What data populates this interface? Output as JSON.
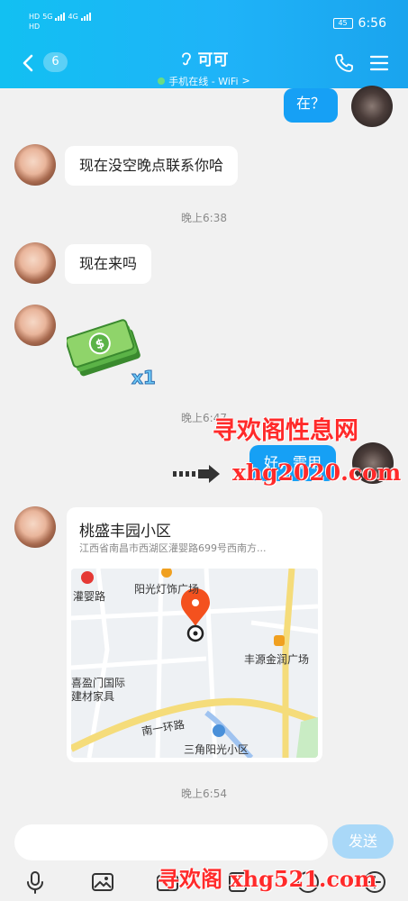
{
  "status": {
    "left_top": "HD",
    "left_bottom": "HD",
    "net_top": "5G",
    "net_mid": "4G",
    "battery": "45",
    "time": "6:56"
  },
  "header": {
    "unread_count": "6",
    "title": "可可",
    "subtitle": "手机在线 - WiFi",
    "subtitle_arrow": ">"
  },
  "messages": {
    "m1": "在？",
    "m2": "现在没空晚点联系你哈",
    "t1": "晚上6:38",
    "m3": "现在来吗",
    "sticker_count": "x1",
    "t2": "晚上6:47",
    "m4": "好，需用",
    "t3": "晚上6:54"
  },
  "location": {
    "title": "桃盛丰园小区",
    "address": "江西省南昌市西湖区灌婴路699号西南方...",
    "map_labels": {
      "road1": "灌婴路",
      "plaza1": "阳光灯饰广场",
      "plaza2": "丰源金润广场",
      "store": "喜盈门国际\n建材家具",
      "ring_road": "南一环路",
      "community": "三角阳光小区"
    }
  },
  "watermark": {
    "top_title": "寻欢阁性息网",
    "top_url": "xhg2020.com",
    "bottom": "寻欢阁 xhg521.com"
  },
  "input": {
    "send_label": "发送"
  },
  "colors": {
    "header_start": "#12c0f2",
    "header_end": "#1aa4ee",
    "my_bubble": "#16a0f5",
    "send_disabled": "#a9d8f8",
    "online_dot": "#6fe07d",
    "map_pin": "#f4511e",
    "watermark": "#ff2a2a"
  }
}
